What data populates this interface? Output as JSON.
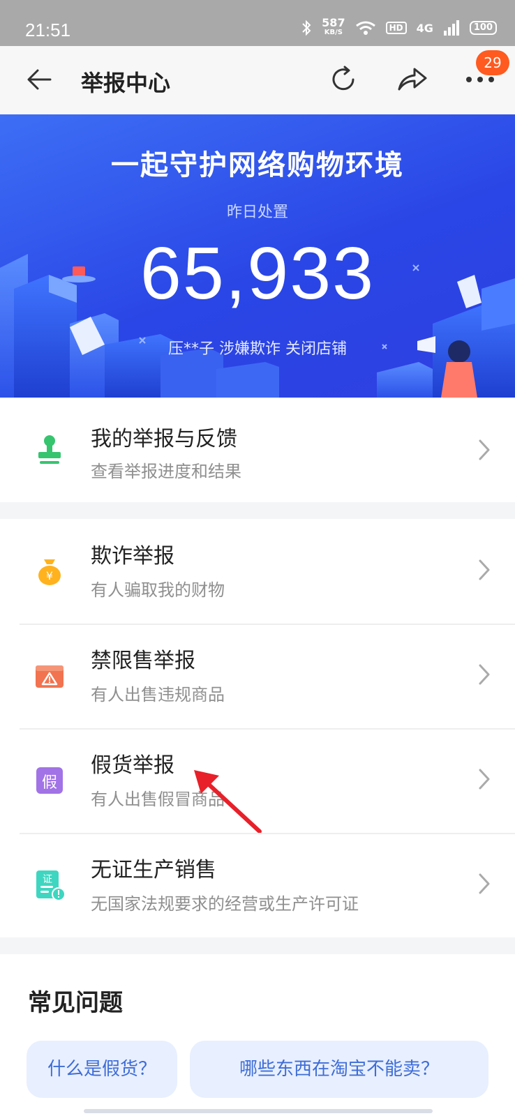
{
  "status_bar": {
    "time": "21:51",
    "speed_value": "587",
    "speed_unit": "KB/S",
    "hd": "HD",
    "network": "4G",
    "battery": "100"
  },
  "nav": {
    "title": "举报中心",
    "badge_count": "29"
  },
  "banner": {
    "title": "一起守护网络购物环境",
    "subtitle": "昨日处置",
    "count": "65,933",
    "ticker": "压**子 涉嫌欺诈 关闭店铺"
  },
  "my_reports": {
    "title": "我的举报与反馈",
    "desc": "查看举报进度和结果",
    "icon": "stamp-icon",
    "icon_color": "#36c46f"
  },
  "report_items": [
    {
      "title": "欺诈举报",
      "desc": "有人骗取我的财物",
      "icon": "money-bag-icon",
      "icon_color": "#ffb21e"
    },
    {
      "title": "禁限售举报",
      "desc": "有人出售违规商品",
      "icon": "warning-box-icon",
      "icon_color": "#f2734f"
    },
    {
      "title": "假货举报",
      "desc": "有人出售假冒商品",
      "icon": "fake-tag-icon",
      "icon_color": "#a173e6",
      "icon_text": "假"
    },
    {
      "title": "无证生产销售",
      "desc": "无国家法规要求的经营或生产许可证",
      "icon": "license-warning-icon",
      "icon_color": "#3ed6c0",
      "icon_text": "证"
    }
  ],
  "faq": {
    "title": "常见问题",
    "chips": [
      "什么是假货？",
      "哪些东西在淘宝不能卖？"
    ]
  },
  "colors": {
    "banner_blue": "#2a46e6",
    "badge_orange": "#ff5a1f",
    "chip_text": "#3e6dd6"
  }
}
